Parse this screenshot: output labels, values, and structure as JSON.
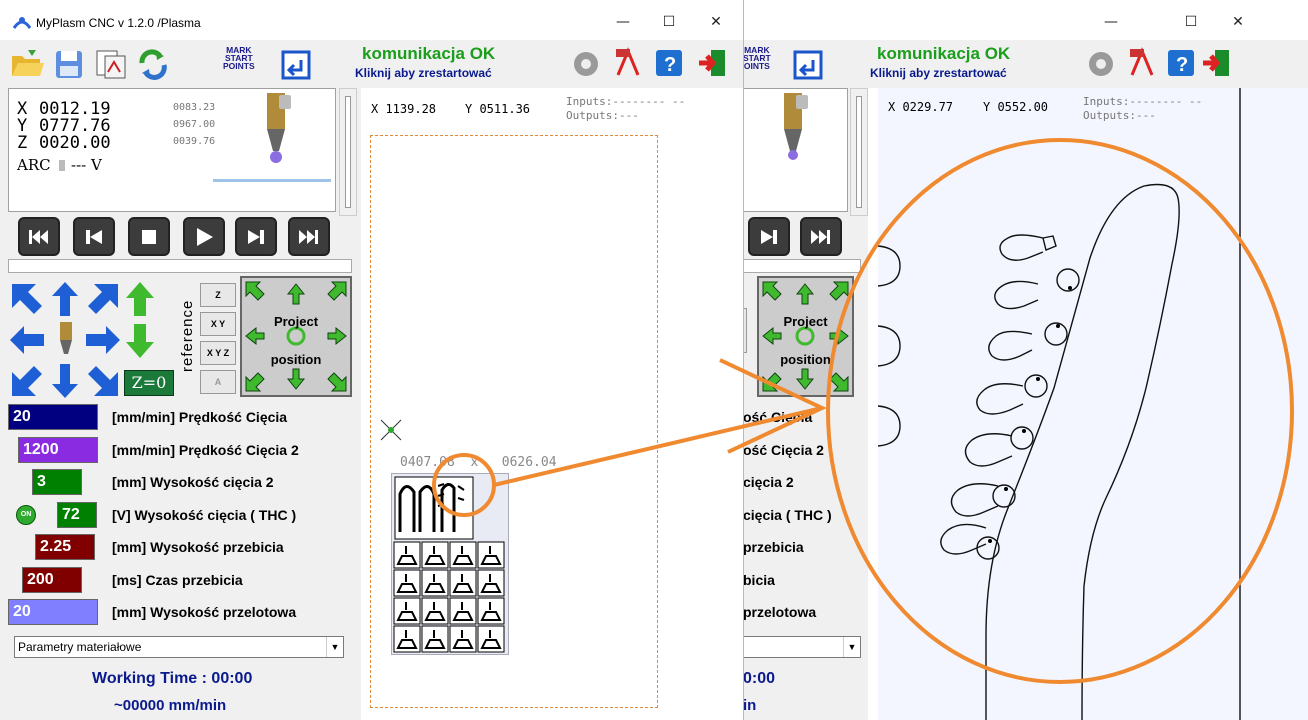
{
  "window": {
    "title": "MyPlasm CNC v 1.2.0  /Plasma",
    "controls": {
      "minimize": "—",
      "maximize": "☐",
      "close": "✕"
    }
  },
  "toolbar": {
    "mark_start_points": [
      "MARK",
      "START",
      "POINTS"
    ],
    "mark_start_points_cut": [
      "MARK",
      "START",
      "OINTS"
    ],
    "status": "komunikacja OK",
    "hint": "Kliknij aby zrestartować",
    "icons": [
      "folder-open-icon",
      "save-icon",
      "import-icon",
      "refresh-icon",
      "return-icon",
      "settings-icon",
      "pdf-icon",
      "help-icon",
      "exit-icon"
    ]
  },
  "coords": {
    "x_label": "X",
    "x": "0012.19",
    "x_small": "0083.23",
    "y_label": "Y",
    "y": "0777.76",
    "y_small": "0967.00",
    "z_label": "Z",
    "z": "0020.00",
    "z_small": "0039.76",
    "arc_label": "ARC",
    "arc_value": "---  V"
  },
  "reference": {
    "label": "reference",
    "z": "Z",
    "xy": "X Y",
    "xyz": "X Y Z",
    "a": "A",
    "z_zero": "Z=0"
  },
  "project_position": {
    "line1": "Project",
    "line2": "position"
  },
  "params": [
    {
      "value": "20",
      "label": "[mm/min] Prędkość Cięcia",
      "color": "#000080"
    },
    {
      "value": "1200",
      "label": "[mm/min] Prędkość Cięcia 2",
      "color": "#8a2be2"
    },
    {
      "value": "3",
      "label": "[mm] Wysokość cięcia 2",
      "color": "#008000"
    },
    {
      "value": "72",
      "label": "[V] Wysokość cięcia ( THC )",
      "color": "#008000",
      "toggle": "ON"
    },
    {
      "value": "2.25",
      "label": "[mm] Wysokość przebicia",
      "color": "#800000"
    },
    {
      "value": "200",
      "label": "[ms] Czas przebicia",
      "color": "#800000"
    },
    {
      "value": "20",
      "label": "[mm] Wysokość przelotowa",
      "color": "#7f7fff"
    }
  ],
  "params_cut": [
    "ość Cięcia",
    "ość Cięcia 2",
    "cięcia 2",
    "cięcia ( THC )",
    "przebicia",
    "bicia",
    "przelotowa"
  ],
  "material_select": "Parametry materiałowe",
  "working_time": "Working Time : 00:00",
  "speed": "~00000 mm/min",
  "working_time_cut": "0:00",
  "speed_cut": "in",
  "canvas1": {
    "coord_x": "X 1139.28",
    "coord_y": "Y 0511.36",
    "inputs": "Inputs:-------- --",
    "outputs": "Outputs:---",
    "piece_coords": "0407.08  x   0626.04"
  },
  "canvas2": {
    "coord_x": "X 0229.77",
    "coord_y": "Y 0552.00",
    "inputs": "Inputs:-------- --",
    "outputs": "Outputs:---"
  },
  "colors": {
    "accent_orange": "#f08a30",
    "status_green": "#1b9e1b",
    "status_blue": "#0a1a8c"
  }
}
